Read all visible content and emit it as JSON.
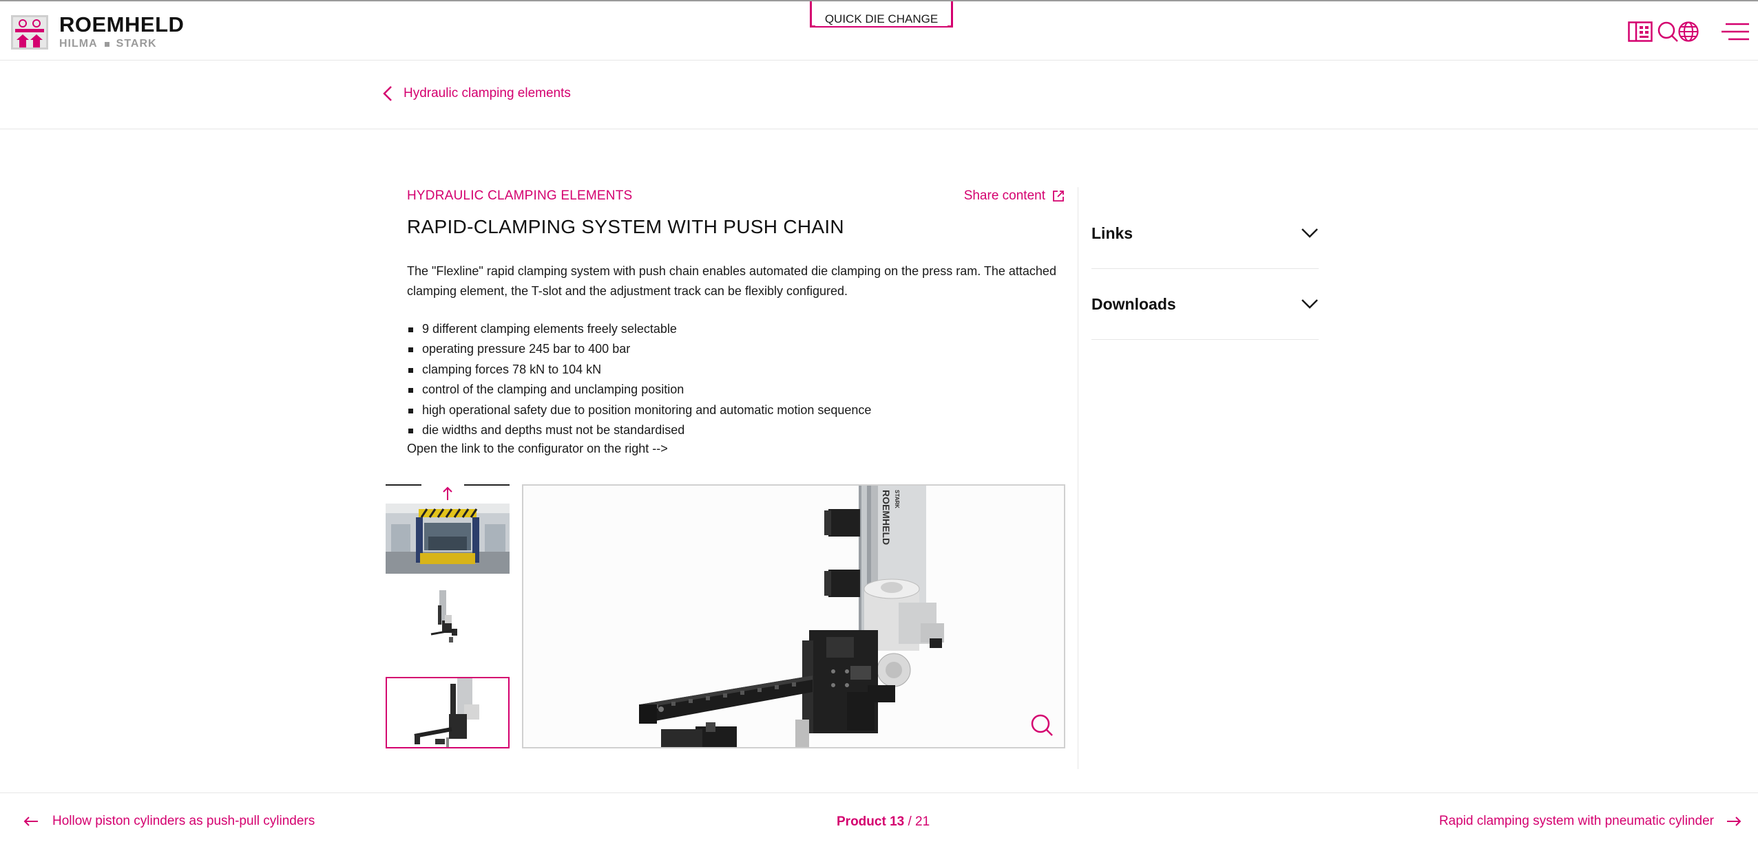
{
  "brand": {
    "name": "ROEMHELD",
    "sub_left": "HILMA",
    "sub_right": "STARK"
  },
  "header": {
    "center_tab": "QUICK DIE CHANGE",
    "icons": [
      "search-icon",
      "catalog-icon",
      "globe-icon",
      "menu-icon"
    ]
  },
  "breadcrumb": {
    "back_label": "Hydraulic clamping elements"
  },
  "product": {
    "category": "HYDRAULIC CLAMPING ELEMENTS",
    "share_label": "Share content",
    "title": "RAPID-CLAMPING SYSTEM WITH PUSH CHAIN",
    "description": "The \"Flexline\" rapid clamping system with push chain enables automated die clamping on the press ram. The attached clamping element, the T-slot and the adjustment track can be flexibly configured.",
    "features": [
      "9 different clamping elements freely selectable",
      "operating pressure 245 bar to 400 bar",
      "clamping forces 78 kN to 104 kN",
      "control of the clamping and unclamping position",
      "high operational safety due to position monitoring and automatic motion sequence",
      "die widths and depths must not be standardised"
    ],
    "cta": "Open the link to the configurator on the right -->"
  },
  "gallery": {
    "thumbnails": [
      "press-machine-photo",
      "push-chain-system-small",
      "push-chain-system-closeup"
    ],
    "selected_index": 2,
    "main_image_brand": "ROEMHELD",
    "main_image_sub": "STARK"
  },
  "sidebar": {
    "sections": [
      {
        "label": "Links"
      },
      {
        "label": "Downloads"
      }
    ]
  },
  "pager": {
    "prev_label": "Hollow piston cylinders as push-pull cylinders",
    "next_label": "Rapid clamping system with pneumatic cylinder",
    "product_word": "Product",
    "current": "13",
    "separator": " / ",
    "total": "21"
  },
  "colors": {
    "accent": "#d4006f",
    "text": "#1a1a1a",
    "divider": "#e6e6e6"
  }
}
